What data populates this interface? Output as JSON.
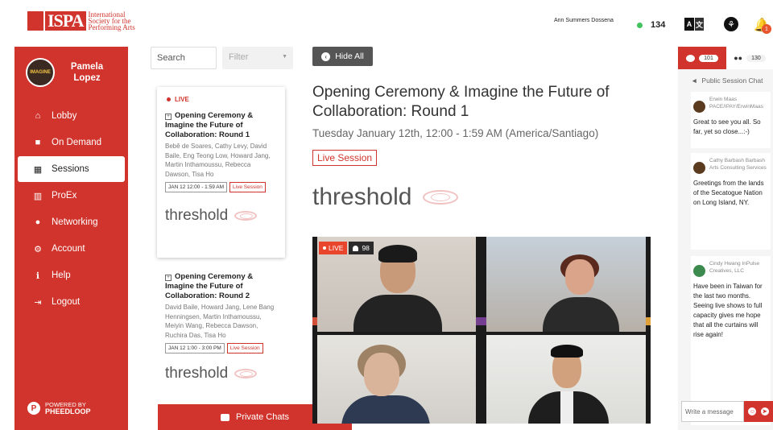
{
  "header": {
    "logo_short": "ISPA",
    "logo_lines": [
      "International",
      "Society for the",
      "Performing Arts"
    ],
    "user_name": "Ann Summers Dossena",
    "online_count": "134",
    "notification_count": "1",
    "translate_labels": [
      "A",
      "文"
    ]
  },
  "sidebar": {
    "profile_name": "Pamela Lopez",
    "avatar_text": "IMAGINE",
    "items": [
      {
        "label": "Lobby",
        "icon": "home-icon",
        "glyph": "⌂",
        "active": false
      },
      {
        "label": "On Demand",
        "icon": "video-camera-icon",
        "glyph": "■",
        "active": false
      },
      {
        "label": "Sessions",
        "icon": "calendar-icon",
        "glyph": "▦",
        "active": true
      },
      {
        "label": "ProEx",
        "icon": "booth-icon",
        "glyph": "▥",
        "active": false
      },
      {
        "label": "Networking",
        "icon": "users-icon",
        "glyph": "●",
        "active": false
      },
      {
        "label": "Account",
        "icon": "gear-icon",
        "glyph": "⚙",
        "active": false
      },
      {
        "label": "Help",
        "icon": "info-icon",
        "glyph": "ℹ",
        "active": false
      },
      {
        "label": "Logout",
        "icon": "logout-icon",
        "glyph": "⇥",
        "active": false
      }
    ],
    "powered_by": "POWERED BY",
    "powered_brand": "PHEEDLOOP"
  },
  "list": {
    "search_placeholder": "Search",
    "filter_label": "Filter",
    "live_label": "LIVE",
    "cards": [
      {
        "title": "Opening Ceremony & Imagine the Future of Collaboration: Round 1",
        "speakers": "Bebê de Soares, Cathy Levy, David Baile, Eng Teong Low, Howard Jang, Martin Inthamoussu, Rebecca Dawson, Tisa Ho",
        "date": "JAN 12 12:00 - 1:59 AM",
        "type": "Live Session",
        "brand": "threshold"
      },
      {
        "title": "Opening Ceremony & Imagine the Future of Collaboration: Round 2",
        "speakers": "David Baile, Howard Jang, Lene Bang Henningsen, Martin Inthamoussu, Meiyin Wang, Rebecca Dawson, Ruchira Das, Tisa Ho",
        "date": "JAN 12 1:00 - 3:00 PM",
        "type": "Live Session",
        "brand": "threshold"
      }
    ],
    "private_chats_label": "Private Chats"
  },
  "session": {
    "hide_all_label": "Hide All",
    "title": "Opening Ceremony & Imagine the Future of Collaboration: Round 1",
    "time": "Tuesday January 12th, 12:00 - 1:59 AM (America/Santiago)",
    "type": "Live Session",
    "brand": "threshold",
    "video_live_label": "LIVE",
    "viewer_count": "98"
  },
  "chat": {
    "tab_chat_count": "101",
    "tab_people_count": "130",
    "header": "Public Session Chat",
    "input_placeholder": "Write a message",
    "messages": [
      {
        "author": "Erwin Maas PACE/IPAY/ErwinMaas",
        "text": "Great to see you all. So far, yet so close...:-)"
      },
      {
        "author": "Cathy Barbash Barbash Arts Consulting Services",
        "text": "Greetings from the lands of the Secatogue Nation on Long Island, NY."
      },
      {
        "author": "Cindy Hwang InPulse Creatives, LLC",
        "text": "Have been in Taiwan for the last two months. Seeing live shows to full capacity gives me hope that all the curtains will rise again!"
      }
    ]
  },
  "colors": {
    "brand_red": "#d0342c",
    "online_green": "#43c35e"
  }
}
